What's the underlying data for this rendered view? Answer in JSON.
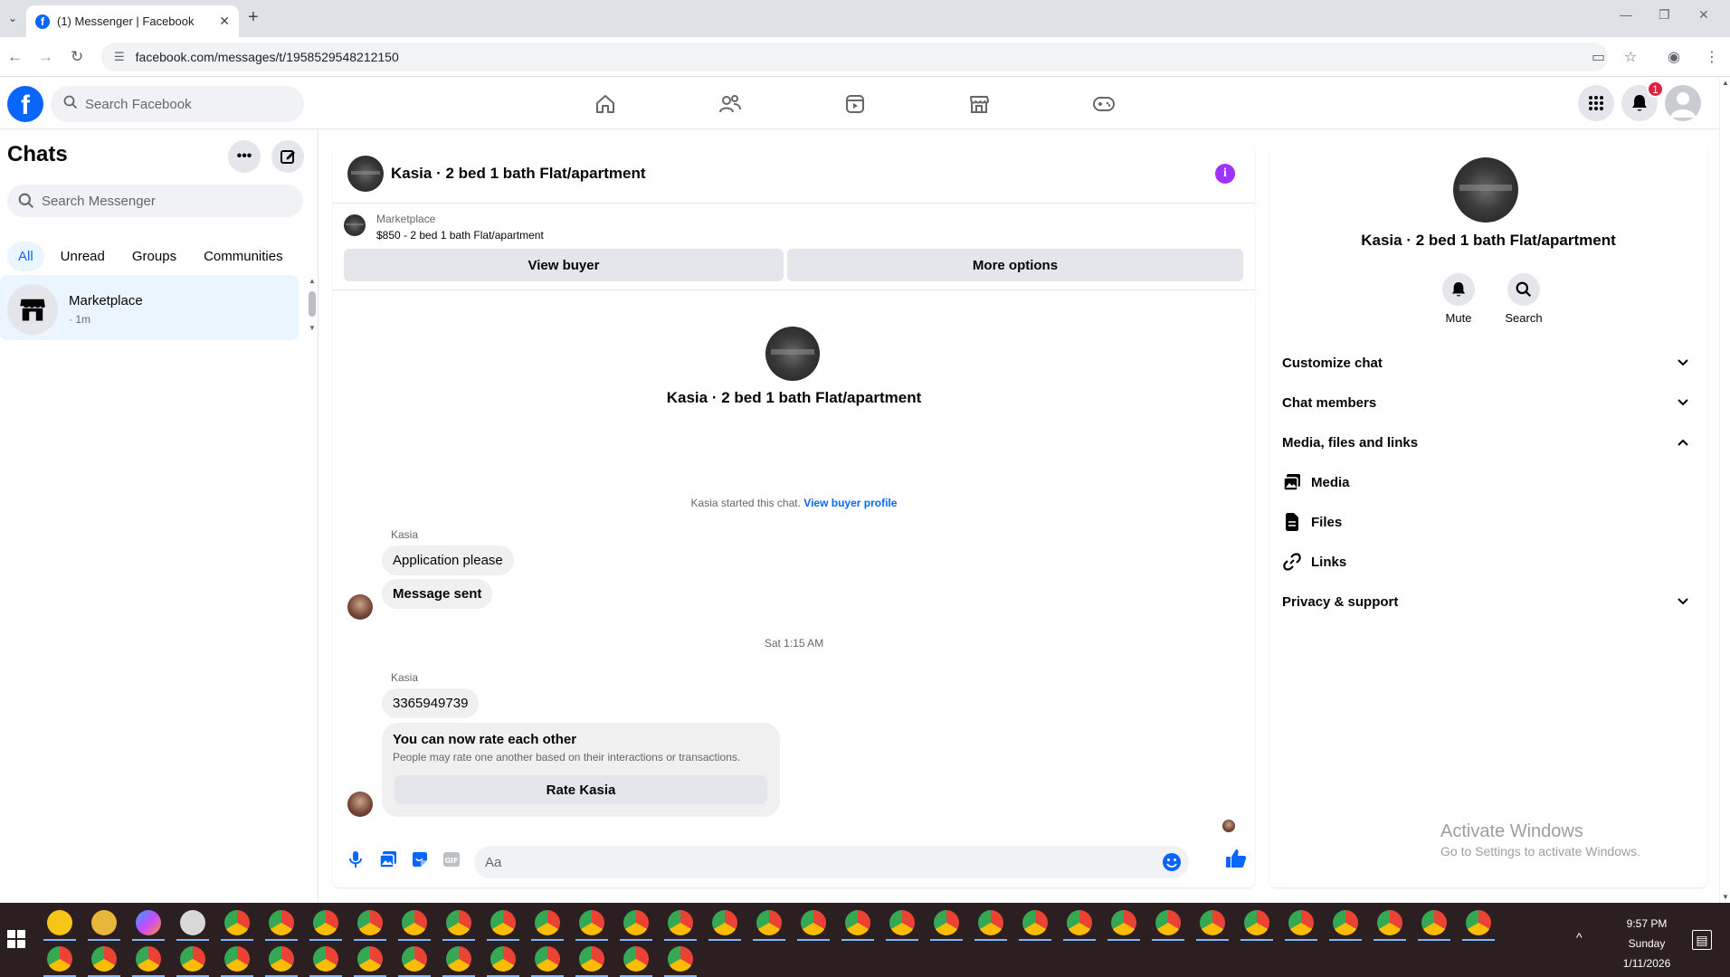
{
  "browser": {
    "tab_title": "(1) Messenger | Facebook",
    "url": "facebook.com/messages/t/1958529548212150"
  },
  "fb": {
    "search_placeholder": "Search Facebook",
    "notification_count": "1",
    "brand_color": "#0866ff"
  },
  "chats": {
    "title": "Chats",
    "search_placeholder": "Search Messenger",
    "filters": [
      "All",
      "Unread",
      "Groups",
      "Communities"
    ],
    "active_filter": "All",
    "items": [
      {
        "name": "Marketplace",
        "time": "· 1m",
        "icon": "marketplace-store-icon"
      }
    ]
  },
  "conversation": {
    "title": "Kasia · 2 bed 1 bath Flat/apartment",
    "marketplace_label": "Marketplace",
    "listing": "$850 - 2 bed 1 bath Flat/apartment",
    "view_buyer": "View buyer",
    "more_options": "More options",
    "intro_name": "Kasia · 2 bed 1 bath Flat/apartment",
    "started_text": "Kasia started this chat.",
    "view_buyer_profile": "View buyer profile",
    "messages": [
      {
        "sender": "Kasia",
        "texts": [
          "Application please",
          "Message sent"
        ]
      },
      {
        "timestamp": "Sat 1:15 AM"
      },
      {
        "sender": "Kasia",
        "texts": [
          "3365949739"
        ]
      }
    ],
    "rate_card": {
      "title": "You can now rate each other",
      "subtitle": "People may rate one another based on their interactions or transactions.",
      "button": "Rate Kasia"
    },
    "composer_placeholder": "Aa"
  },
  "info_panel": {
    "name": "Kasia · 2 bed 1 bath Flat/apartment",
    "actions": [
      {
        "label": "Mute",
        "icon": "bell-icon"
      },
      {
        "label": "Search",
        "icon": "search-icon"
      }
    ],
    "sections": [
      {
        "label": "Customize chat",
        "expanded": false
      },
      {
        "label": "Chat members",
        "expanded": false
      },
      {
        "label": "Media, files and links",
        "expanded": true
      },
      {
        "label": "Privacy & support",
        "expanded": false
      }
    ],
    "media_items": [
      "Media",
      "Files",
      "Links"
    ]
  },
  "watermark": {
    "line1": "Activate Windows",
    "line2": "Go to Settings to activate Windows."
  },
  "taskbar": {
    "time": "9:57 PM",
    "day": "Sunday",
    "date": "1/11/2026"
  }
}
